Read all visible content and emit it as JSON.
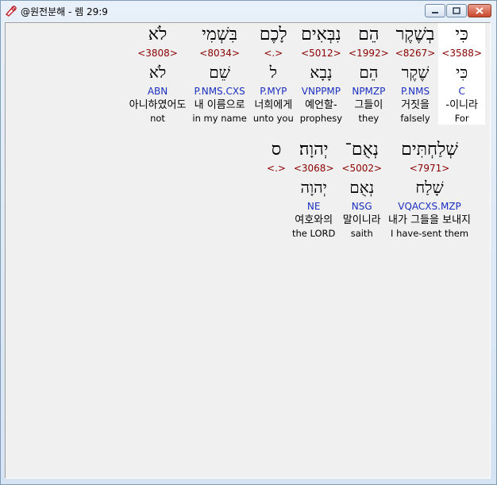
{
  "window": {
    "title": "@원전분해 - 렘 29:9",
    "colors": {
      "strong": "#8b0000",
      "morph": "#1a2fbf",
      "selected_bg": "#ffffff"
    }
  },
  "row1": [
    {
      "heb": "כִּי",
      "strong": "<3588>",
      "lemma": "כִּי",
      "morph": "C",
      "korean": "-이니라",
      "english": "For",
      "selected": true
    },
    {
      "heb": "בְשֶׁקֶר",
      "strong": "<8267>",
      "lemma": "שֶׁקֶר",
      "morph": "P.NMS",
      "korean": "거짓을",
      "english": "falsely"
    },
    {
      "heb": "הֵם",
      "strong": "<1992>",
      "lemma": "הֵם",
      "morph": "NPMZP",
      "korean": "그들이",
      "english": "they"
    },
    {
      "heb": "נִבְּאִים",
      "strong": "<5012>",
      "lemma": "נָבָא",
      "morph": "VNPPMP",
      "korean": "예언할-",
      "english": "prophesy"
    },
    {
      "heb": "לָכֶם",
      "strong": "<.>",
      "lemma": "ל",
      "morph": "P.MYP",
      "korean": "너희에게",
      "english": "unto you"
    },
    {
      "heb": "בִּשְׁמִי",
      "strong": "<8034>",
      "lemma": "שֵׁם",
      "morph": "P.NMS.CXS",
      "korean": "내 이름으로",
      "english": "in my name"
    },
    {
      "heb": "לֹא",
      "strong": "<3808>",
      "lemma": "לֹא",
      "morph": "ABN",
      "korean": "아니하였어도",
      "english": "not"
    }
  ],
  "row2": [
    {
      "heb": "שְׁלַחְתִּים",
      "strong": "<7971>",
      "lemma": "שָׁלַח",
      "morph": "VQACXS.MZP",
      "korean": "내가 그들을 보내지",
      "english": "I have-sent them"
    },
    {
      "heb": "נְאֻם־",
      "strong": "<5002>",
      "lemma": "נְאֻם",
      "morph": "NSG",
      "korean": "말이니라",
      "english": "saith"
    },
    {
      "heb": "יְהוָה׃",
      "strong": "<3068>",
      "lemma": "יְהוָה",
      "morph": "NE",
      "korean": "여호와의",
      "english": "the LORD"
    },
    {
      "heb": "ס",
      "strong": "<.>",
      "lemma": "",
      "morph": "",
      "korean": "",
      "english": ""
    }
  ]
}
